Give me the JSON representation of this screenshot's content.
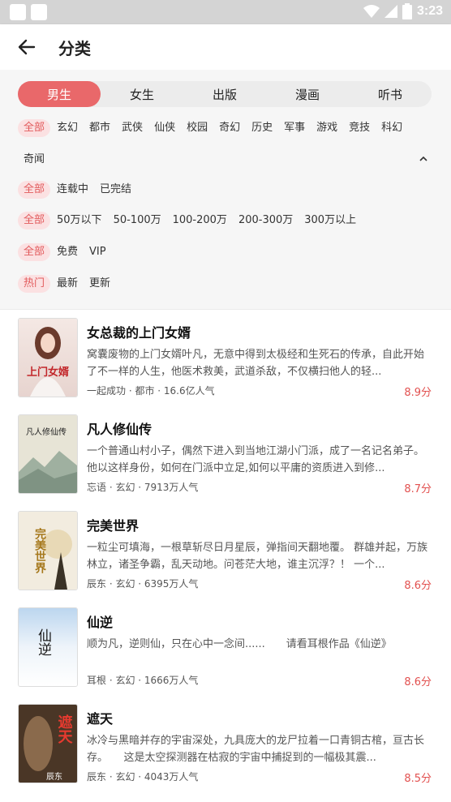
{
  "status_bar": {
    "time": "3:23"
  },
  "header": {
    "title": "分类"
  },
  "tabs": [
    {
      "label": "男生",
      "active": true
    },
    {
      "label": "女生",
      "active": false
    },
    {
      "label": "出版",
      "active": false
    },
    {
      "label": "漫画",
      "active": false
    },
    {
      "label": "听书",
      "active": false
    }
  ],
  "filters": {
    "genre": [
      "全部",
      "玄幻",
      "都市",
      "武侠",
      "仙侠",
      "校园",
      "奇幻",
      "历史",
      "军事",
      "游戏",
      "竞技",
      "科幻"
    ],
    "genre_extra": [
      "奇闻"
    ],
    "status": [
      "全部",
      "连载中",
      "已完结"
    ],
    "wordcount": [
      "全部",
      "50万以下",
      "50-100万",
      "100-200万",
      "200-300万",
      "300万以上"
    ],
    "price": [
      "全部",
      "免费",
      "VIP"
    ],
    "sort": [
      "热门",
      "最新",
      "更新"
    ]
  },
  "books": [
    {
      "title": "女总裁的上门女婿",
      "desc": "窝囊废物的上门女婿叶凡，无意中得到太极经和生死石的传承，自此开始了不一样的人生，他医术救美，武道杀敌，不仅横扫他人的轻...",
      "meta": "一起成功 · 都市 · 16.6亿人气",
      "score": "8.9分",
      "cover_text": "上门女婿"
    },
    {
      "title": "凡人修仙传",
      "desc": "一个普通山村小子，偶然下进入到当地江湖小门派，成了一名记名弟子。他以这样身份，如何在门派中立足,如何以平庸的资质进入到修...",
      "meta": "忘语 · 玄幻 · 7913万人气",
      "score": "8.7分",
      "cover_text": "凡人修仙传"
    },
    {
      "title": "完美世界",
      "desc": "一粒尘可填海，一根草斩尽日月星辰，弹指间天翻地覆。 群雄并起，万族林立，诸圣争霸，乱天动地。问苍茫大地，谁主沉浮？！ 一个...",
      "meta": "辰东 · 玄幻 · 6395万人气",
      "score": "8.6分",
      "cover_text": "完美世界"
    },
    {
      "title": "仙逆",
      "desc": "顺为凡，逆则仙，只在心中一念间......　　请看耳根作品《仙逆》",
      "meta": "耳根 · 玄幻 · 1666万人气",
      "score": "8.6分",
      "cover_text": "仙逆"
    },
    {
      "title": "遮天",
      "desc": "冰冷与黑暗并存的宇宙深处，九具庞大的龙尸拉着一口青铜古棺，亘古长存。　　这是太空探测器在枯寂的宇宙中捕捉到的一幅极其震...",
      "meta": "辰东 · 玄幻 · 4043万人气",
      "score": "8.5分",
      "cover_text": "遮天",
      "cover_author": "辰东"
    }
  ],
  "colors": {
    "accent": "#e9686a",
    "score": "#e2504f",
    "chip_bg": "#fbe1e2"
  }
}
